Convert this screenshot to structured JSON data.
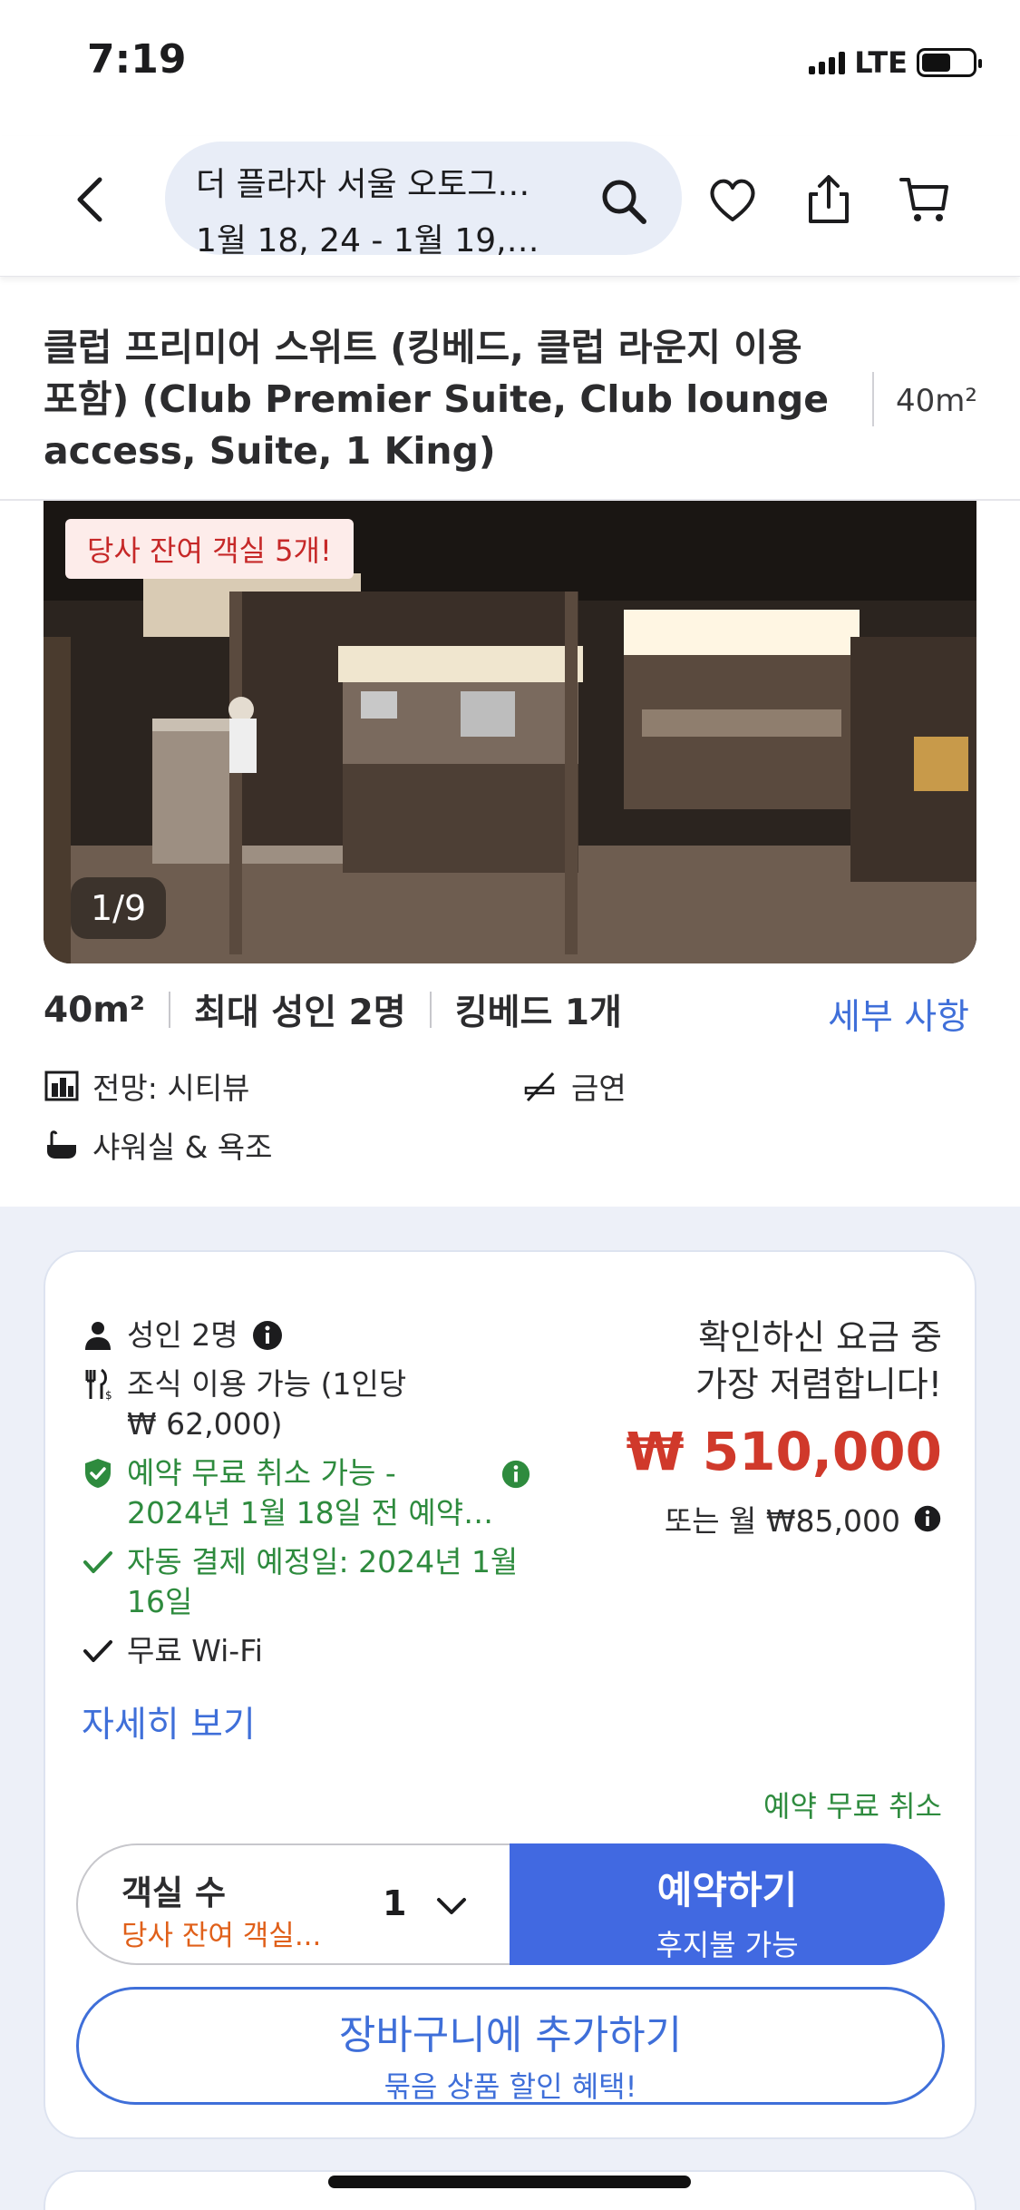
{
  "status_bar": {
    "time": "7:19",
    "network": "LTE"
  },
  "header": {
    "hotel_name": "더 플라자 서울 오토그…",
    "dates": "1월 18, 24 - 1월 19,…",
    "icons": [
      "back-arrow-icon",
      "search-icon",
      "heart-icon",
      "share-icon",
      "cart-icon"
    ]
  },
  "room": {
    "title": "클럽 프리미어 스위트 (킹베드, 클럽 라운지 이용 포함) (Club Premier Suite, Club lounge access, Suite, 1 King)",
    "size": "40m²"
  },
  "photo": {
    "badge": "당사 잔여 객실 5개!",
    "counter": "1/9"
  },
  "specs": {
    "size": "40m²",
    "max_adults": "최대 성인 2명",
    "bed": "킹베드 1개",
    "details_link": "세부 사항"
  },
  "features": {
    "view": "전망: 시티뷰",
    "smoking": "금연",
    "bath": "샤워실 & 욕조"
  },
  "offer": {
    "adults": "성인 2명",
    "breakfast_line1": "조식 이용 가능 (1인당",
    "breakfast_line2": "₩ 62,000)",
    "free_cancel_line1": "예약 무료 취소 가능 -",
    "free_cancel_line2": "2024년 1월 18일 전 예약…",
    "auto_pay_line1": "자동 결제 예정일: 2024년 1월",
    "auto_pay_line2": "16일",
    "wifi": "무료 Wi-Fi",
    "more_link": "자세히 보기",
    "cheapest_line1": "확인하신 요금 중",
    "cheapest_line2": "가장 저렴합니다!",
    "price": "₩ 510,000",
    "monthly": "또는 월 ₩85,000",
    "free_cancel_tag": "예약 무료 취소",
    "rooms_label": "객실 수",
    "rooms_warning": "당사 잔여 객실...",
    "rooms_qty": "1",
    "book_label": "예약하기",
    "book_sub": "후지불 가능",
    "cart_label": "장바구니에 추가하기",
    "cart_sub": "묶음 상품 할인 혜택!"
  },
  "colors": {
    "accent": "#4169e1",
    "price": "#d0392b",
    "green": "#2e8b3e",
    "warning": "#e0601a"
  }
}
